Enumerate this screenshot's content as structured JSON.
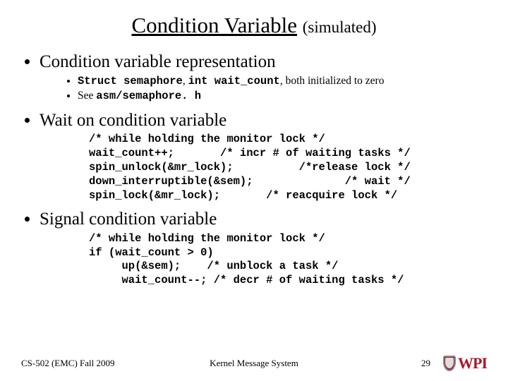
{
  "title": {
    "main": "Condition Variable",
    "paren": "(simulated)"
  },
  "sections": [
    {
      "heading": "Condition variable representation",
      "sub": [
        {
          "prefix": "Struct semaphore",
          "mid": ", ",
          "code2": "int wait_count",
          "suffix": ", both initialized to zero"
        },
        {
          "prefix": "See ",
          "code2": "asm/semaphore. h"
        }
      ]
    },
    {
      "heading": "Wait on condition variable",
      "code": "/* while holding the monitor lock */\nwait_count++;       /* incr # of waiting tasks */\nspin_unlock(&mr_lock);          /*release lock */\ndown_interruptible(&sem);              /* wait */\nspin_lock(&mr_lock);       /* reacquire lock */"
    },
    {
      "heading": "Signal condition variable",
      "code": "/* while holding the monitor lock */\nif (wait_count > 0)\n     up(&sem);    /* unblock a task */\n     wait_count--; /* decr # of waiting tasks */"
    }
  ],
  "footer": {
    "left": "CS-502 (EMC) Fall 2009",
    "center": "Kernel Message System",
    "page": "29",
    "logo_text": "WPI"
  }
}
